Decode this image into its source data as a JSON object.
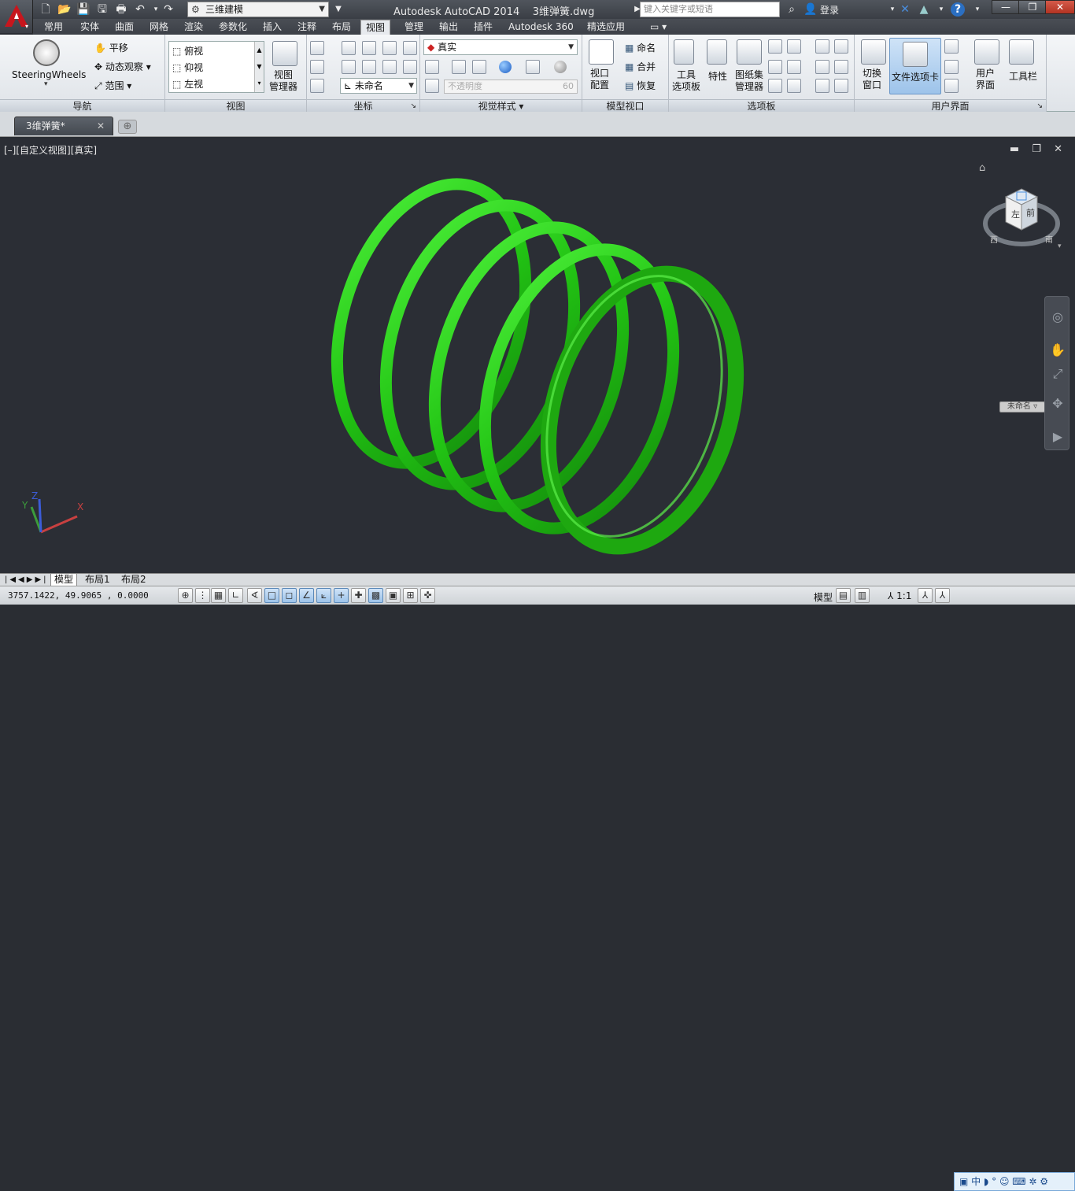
{
  "app": {
    "title": "Autodesk AutoCAD 2014",
    "file": "3维弹簧.dwg",
    "workspace": "三维建模",
    "search_placeholder": "键入关键字或短语",
    "login": "登录"
  },
  "ribbon_tabs": [
    "常用",
    "实体",
    "曲面",
    "网格",
    "渲染",
    "参数化",
    "插入",
    "注释",
    "布局",
    "视图",
    "管理",
    "输出",
    "插件",
    "Autodesk 360",
    "精选应用"
  ],
  "active_tab": "视图",
  "panels": {
    "nav": {
      "title": "导航",
      "steering": "SteeringWheels",
      "pan": "平移",
      "orbit": "动态观察",
      "extent": "范围"
    },
    "views": {
      "title": "视图",
      "items": [
        "俯视",
        "仰视",
        "左视"
      ],
      "manager": "视图\n管理器"
    },
    "coords": {
      "title": "坐标",
      "ucs_name": "未命名"
    },
    "visual": {
      "title": "视觉样式",
      "style": "真实",
      "opacity_label": "不透明度",
      "opacity_value": "60"
    },
    "model_vp": {
      "title": "模型视口",
      "config": "视口\n配置",
      "named": "命名",
      "join": "合并",
      "restore": "恢复"
    },
    "palettes": {
      "title": "选项板",
      "tool": "工具\n选项板",
      "props": "特性",
      "sheet": "图纸集\n管理器"
    },
    "ui": {
      "title": "用户界面",
      "switch": "切换\n窗口",
      "filetabs": "文件选项卡",
      "user": "用户\n界面",
      "toolbar": "工具栏"
    }
  },
  "file_tab": "3维弹簧*",
  "viewport": {
    "label": "[–][自定义视图][真实]",
    "viewcube_face": "前",
    "viewcube_left": "左",
    "viewcube_west": "西",
    "viewcube_south": "南",
    "ucs_name": "未命名",
    "spring_color": "#22c414",
    "bg_color": "#2b2e35"
  },
  "layout_tabs": [
    "模型",
    "布局1",
    "布局2"
  ],
  "status": {
    "coords": "3757.1422, 49.9065 , 0.0000",
    "model": "模型",
    "annotation_scale": "1:1",
    "ime": "中"
  }
}
